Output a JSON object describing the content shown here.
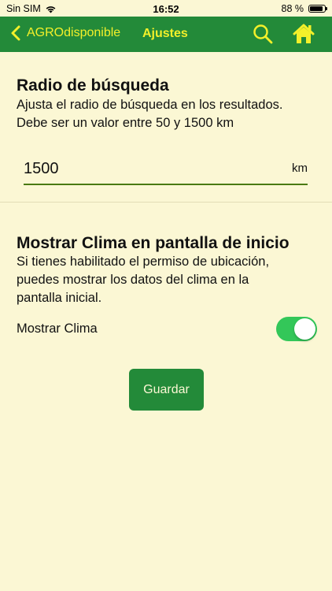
{
  "status_bar": {
    "carrier": "Sin SIM",
    "time": "16:52",
    "battery_text": "88 %",
    "battery_level": 0.88
  },
  "nav": {
    "back_label": "AGROdisponible",
    "title": "Ajustes",
    "icons": [
      "chevron-left-icon",
      "search-icon",
      "home-icon"
    ],
    "colors": {
      "bar": "#238a39",
      "foreground": "#f3f02a"
    }
  },
  "radius": {
    "title": "Radio de búsqueda",
    "desc_line1": "Ajusta el radio de búsqueda en los resultados.",
    "desc_line2": "Debe ser un valor entre 50 y 1500 km",
    "value": "1500",
    "unit": "km"
  },
  "weather": {
    "title": "Mostrar Clima en pantalla de inicio",
    "desc_line1": "Si tienes habilitado el permiso de ubicación,",
    "desc_line2": "puedes mostrar los datos del clima en la",
    "desc_line3": "pantalla inicial.",
    "toggle_label": "Mostrar Clima",
    "toggle_on": true
  },
  "save_label": "Guardar",
  "colors": {
    "background": "#fbf7d4",
    "toggle_on": "#33c759",
    "button": "#238a39"
  }
}
